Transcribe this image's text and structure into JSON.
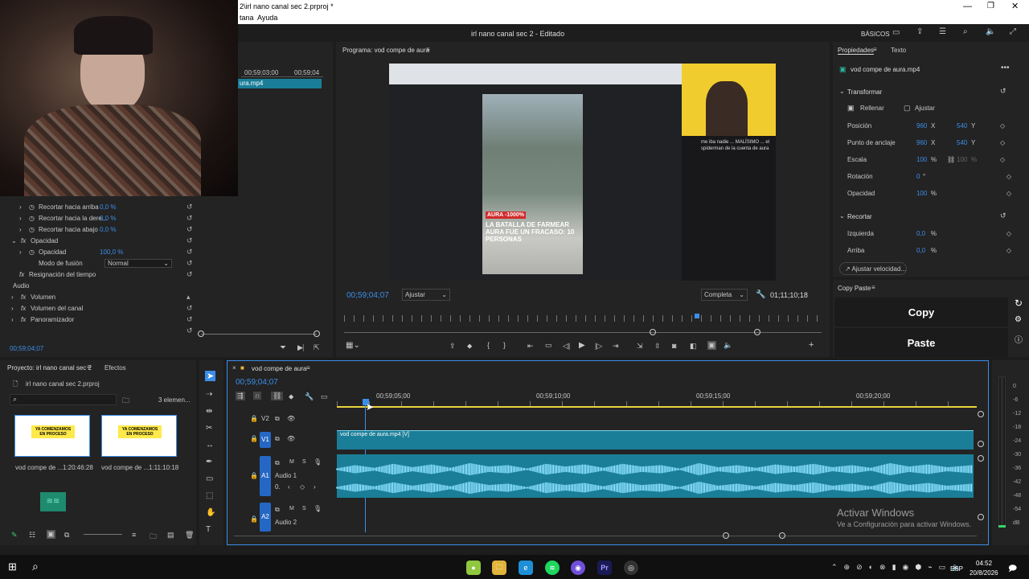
{
  "titlebar": {
    "title": "2\\irl nano canal sec 2.prproj *",
    "menu": [
      "tana",
      "Ayuda"
    ]
  },
  "workspace": {
    "title": "irl nano canal sec 2 - Editado",
    "label": "BÁSICOS"
  },
  "source_timecodes": {
    "t1": "00;59;03;00",
    "t2": "00;59;04"
  },
  "source_clip": "ura.mp4",
  "effects": {
    "rows": [
      {
        "label": "Recortar hacia arriba",
        "value": "0,0 %"
      },
      {
        "label": "Recortar hacia la dere...",
        "value": "0,0 %"
      },
      {
        "label": "Recortar hacia abajo",
        "value": "0,0 %"
      }
    ],
    "opacidad_group": "Opacidad",
    "opacidad_label": "Opacidad",
    "opacidad_value": "100,0 %",
    "blend_label": "Modo de fusión",
    "blend_value": "Normal",
    "time_remap": "Resignación del tiempo",
    "audio": "Audio",
    "volumen": "Volumen",
    "volumen_canal": "Volumen del canal",
    "panoramizador": "Panoramizador",
    "timecode": "00;59;04;07"
  },
  "program": {
    "label": "Programa: vod compe de aura",
    "timecode": "00;59;04;07",
    "fit": "Ajustar",
    "quality": "Completa",
    "duration": "01;11;10;18",
    "video_caption": "AURA -1000%",
    "video_text": "LA BATALLA DE FARMEAR AURA FUE UN FRACASO: 10 PERSONAS",
    "video_side_text": "me iba nadie ... MALÍSIMO ... el spiderman de la cuenta de aura"
  },
  "properties": {
    "tabs": [
      "Propiedades",
      "Texto"
    ],
    "clip": "vod compe de aura.mp4",
    "transform": "Transformar",
    "fill": "Rellenar",
    "fit": "Ajustar",
    "rows": [
      {
        "label": "Posición",
        "v1": "960",
        "u1": "X",
        "v2": "540",
        "u2": "Y"
      },
      {
        "label": "Punto de anclaje",
        "v1": "960",
        "u1": "X",
        "v2": "540",
        "u2": "Y"
      },
      {
        "label": "Escala",
        "v1": "100",
        "u1": "%",
        "v2": "100",
        "u2": "%"
      },
      {
        "label": "Rotación",
        "v1": "0",
        "u1": "°"
      },
      {
        "label": "Opacidad",
        "v1": "100",
        "u1": "%"
      }
    ],
    "crop": "Recortar",
    "crop_rows": [
      {
        "label": "Izquierda",
        "v1": "0,0",
        "u1": "%"
      },
      {
        "label": "Arriba",
        "v1": "0,0",
        "u1": "%"
      }
    ],
    "speed_button": "Ajustar velocidad..."
  },
  "copypaste": {
    "title": "Copy Paste",
    "copy": "Copy",
    "paste": "Paste"
  },
  "project": {
    "tab1": "Proyecto: irl nano canal sec 2",
    "tab2": "Efectos",
    "file": "irl nano canal sec 2.prproj",
    "count": "3 elemen...",
    "items": [
      {
        "name": "vod compe de ...",
        "duration": "1:20:46:28",
        "thumb": "YA COMENZAMOS EN PROCESO"
      },
      {
        "name": "vod compe de ...",
        "duration": "1:11:10:18",
        "thumb": "YA COMENZAMOS EN PROCESO"
      }
    ]
  },
  "timeline": {
    "sequence": "vod compe de aura",
    "timecode": "00;59;04;07",
    "ruler": [
      "00;59;05;00",
      "00;59;10;00",
      "00;59;15;00",
      "00;59;20;00"
    ],
    "tracks": [
      {
        "id": "V2",
        "name": ""
      },
      {
        "id": "V1",
        "name": ""
      },
      {
        "id": "A1",
        "name": "Audio 1"
      },
      {
        "id": "A2",
        "name": "Audio 2"
      }
    ],
    "video_clip": "vod compe de aura.mp4 [V]"
  },
  "meter": {
    "labels": [
      "0",
      "-6",
      "-12",
      "-18",
      "-24",
      "-30",
      "-36",
      "-42",
      "-48",
      "-54",
      "dB"
    ]
  },
  "watermark": {
    "title": "Activar Windows",
    "subtitle": "Ve a Configuración para activar Windows."
  },
  "taskbar": {
    "lang": "ESP",
    "time": "04:52",
    "date": "20/8/2026"
  },
  "colors": {
    "accent": "#3b8eea",
    "clip": "#1a7e98",
    "waveform": "#7fd4ee"
  }
}
